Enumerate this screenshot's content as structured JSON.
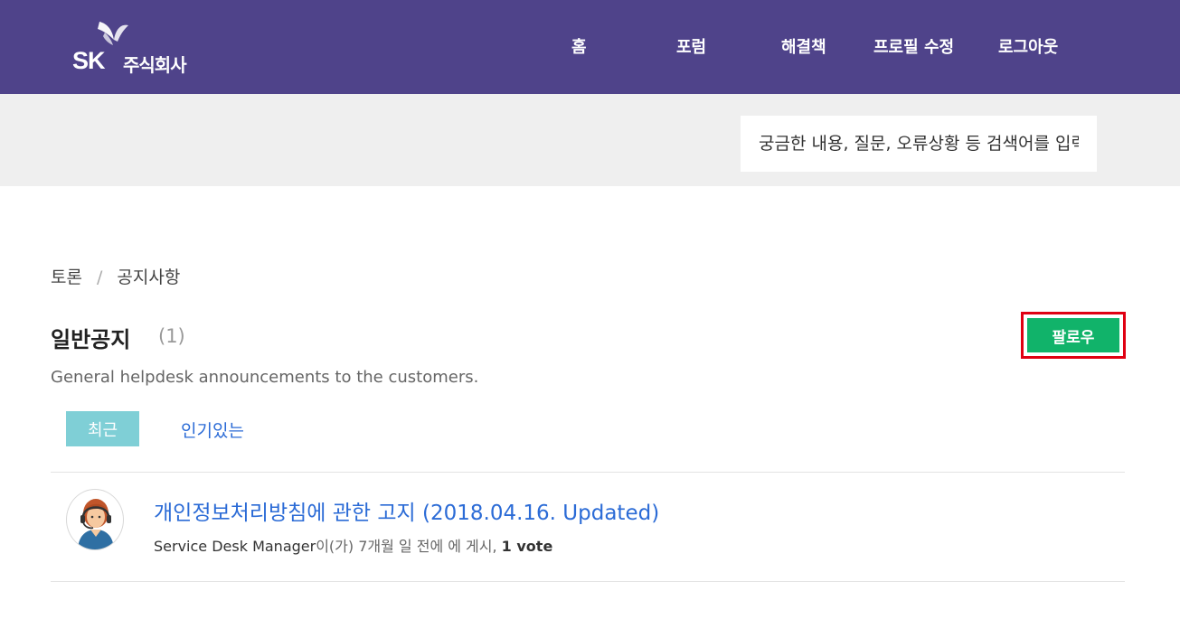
{
  "header": {
    "logo": {
      "brand": "SK",
      "name": "주식회사"
    },
    "nav": [
      {
        "label": "홈"
      },
      {
        "label": "포럼"
      },
      {
        "label": "해결책"
      },
      {
        "label": "프로필 수정"
      },
      {
        "label": "로그아웃"
      }
    ],
    "colors": {
      "bar": "#4f438a",
      "band": "#efefef"
    }
  },
  "search": {
    "placeholder": "궁금한 내용, 질문, 오류상황 등 검색어를 입력하세요"
  },
  "breadcrumb": [
    {
      "label": "토론"
    },
    {
      "label": "공지사항"
    }
  ],
  "forum": {
    "title": "일반공지",
    "count": "(1)",
    "description": "General helpdesk announcements to the customers.",
    "follow_label": "팔로우",
    "follow_color": "#11b36a"
  },
  "tabs": [
    {
      "label": "최근",
      "active": true
    },
    {
      "label": "인기있는",
      "active": false
    }
  ],
  "posts": [
    {
      "title": "개인정보처리방침에 관한 고지 (2018.04.16. Updated)",
      "author": "Service Desk Manager",
      "meta_suffix": "이(가) 7개월 일 전에 에 게시, ",
      "votes": "1 vote",
      "avatar_icon": "support-agent-avatar-icon"
    }
  ]
}
